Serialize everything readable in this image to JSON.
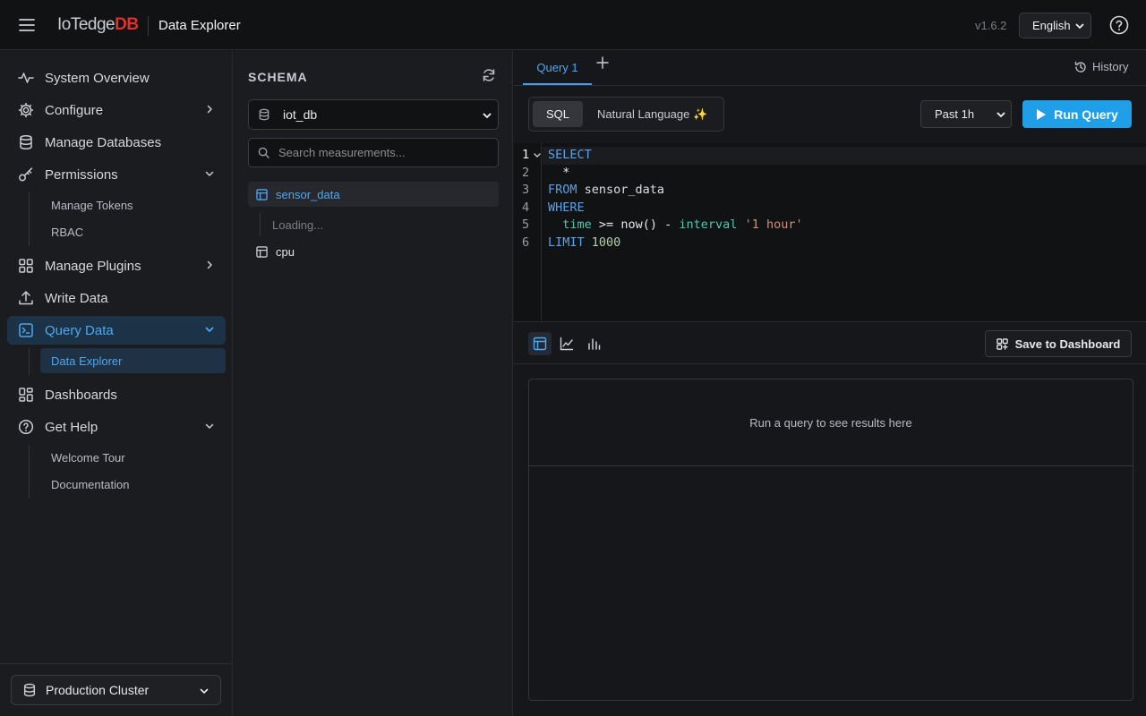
{
  "header": {
    "logo_part1": "IoTedge",
    "logo_part2": "DB",
    "title": "Data Explorer",
    "version": "v1.6.2",
    "language": "English"
  },
  "sidebar": {
    "items": [
      {
        "label": "System Overview",
        "icon": "activity-icon"
      },
      {
        "label": "Configure",
        "icon": "gear-icon"
      },
      {
        "label": "Manage Databases",
        "icon": "database-icon"
      },
      {
        "label": "Permissions",
        "icon": "key-icon",
        "sub": [
          "Manage Tokens",
          "RBAC"
        ]
      },
      {
        "label": "Manage Plugins",
        "icon": "grid-icon"
      },
      {
        "label": "Write Data",
        "icon": "upload-icon"
      },
      {
        "label": "Query Data",
        "icon": "terminal-icon",
        "sub": [
          "Data Explorer"
        ]
      },
      {
        "label": "Dashboards",
        "icon": "dashboard-icon"
      },
      {
        "label": "Get Help",
        "icon": "help-icon",
        "sub": [
          "Welcome Tour",
          "Documentation"
        ]
      }
    ],
    "cluster": "Production Cluster"
  },
  "schema": {
    "title": "SCHEMA",
    "database": "iot_db",
    "search_placeholder": "Search measurements...",
    "measurements": [
      "sensor_data",
      "cpu"
    ],
    "loading_text": "Loading..."
  },
  "tabs": {
    "active": "Query 1",
    "history": "History"
  },
  "toolbar": {
    "mode_sql": "SQL",
    "mode_nl": "Natural Language ✨",
    "time_range": "Past 1h",
    "run": "Run Query"
  },
  "editor": {
    "lines": [
      "SELECT",
      "  *",
      "FROM sensor_data",
      "WHERE",
      "  time >= now() - interval '1 hour'",
      "LIMIT 1000"
    ]
  },
  "results": {
    "save_dashboard": "Save to Dashboard",
    "empty_message": "Run a query to see results here"
  },
  "colors": {
    "accent": "#1e9fe8",
    "active_text": "#4da8f0",
    "logo_red": "#e0312b"
  }
}
